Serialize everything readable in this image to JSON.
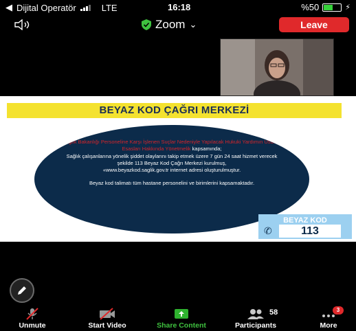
{
  "status_bar": {
    "back_label": "Dijital Operatör",
    "network": "LTE",
    "time": "16:18",
    "battery_percent": "%50",
    "battery_level": 0.5
  },
  "top_bar": {
    "title": "Zoom",
    "leave_label": "Leave"
  },
  "shared_slide": {
    "banner_title": "BEYAZ KOD ÇAĞRI MERKEZİ",
    "body_red": "Sağlık Bakanlığı Personeline Karşı İşlenen Suçlar Nedeniyle Yapılacak Hukuki Yardımın Usul ve Esasları Hakkında Yönetmelik",
    "body_line1": " kapsamında;",
    "body_line2": "Sağlık çalışanlarına yönelik şiddet olaylarını takip etmek üzere 7 gün 24 saat hizmet verecek şekilde 113 Beyaz Kod Çağrı Merkezi kurulmuş,",
    "body_line3": "«www.beyazkod.saglik.gov.tr internet adresi oluşturulmuştur.",
    "body_line4": "Beyaz kod talimatı tüm hastane personelini ve birimlerini kapsamaktadır.",
    "logo_label": "BEYAZ KOD",
    "logo_number": "113"
  },
  "toolbar": {
    "unmute_label": "Unmute",
    "start_video_label": "Start Video",
    "share_label": "Share Content",
    "participants_label": "Participants",
    "participants_count": "58",
    "more_label": "More",
    "more_badge": "3"
  },
  "colors": {
    "leave_red": "#e0292b",
    "share_green": "#3fc13f",
    "banner_yellow": "#f4e22f",
    "ellipse_navy": "#0c2b4a"
  }
}
